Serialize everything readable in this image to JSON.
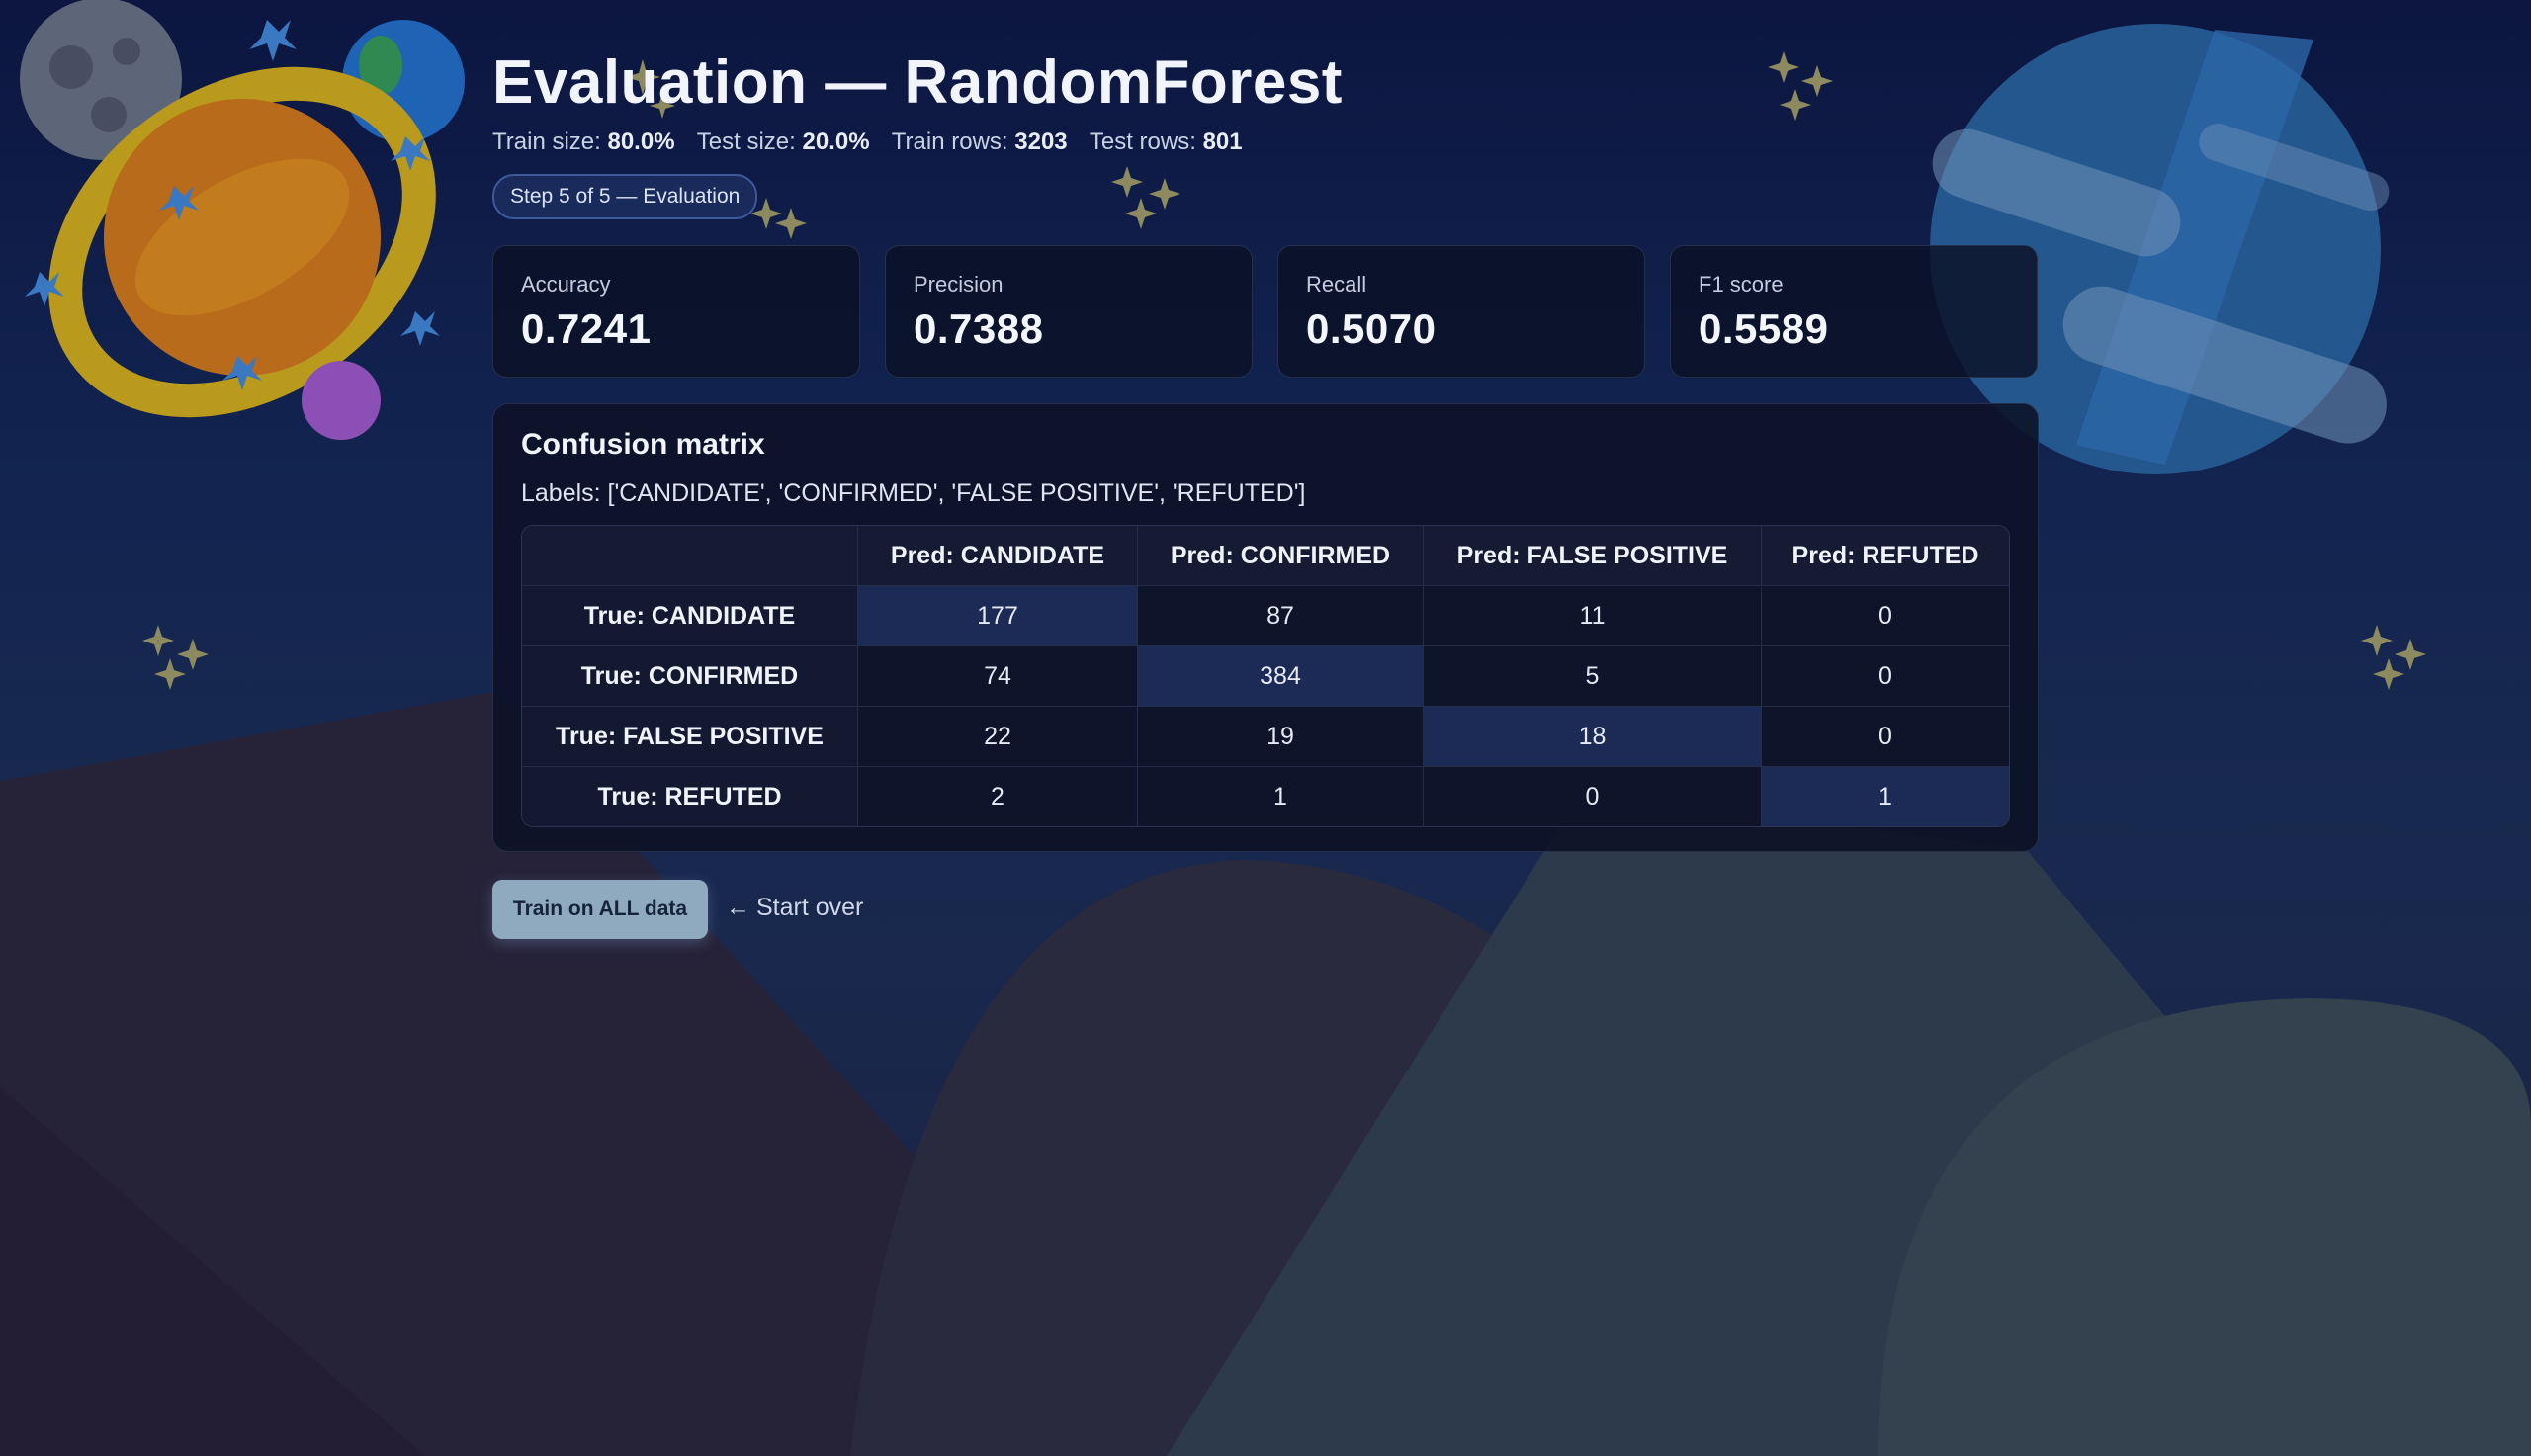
{
  "header": {
    "title": "Evaluation — RandomForest",
    "split": [
      {
        "label": "Train size:",
        "value": "80.0%"
      },
      {
        "label": "Test size:",
        "value": "20.0%"
      },
      {
        "label": "Train rows:",
        "value": "3203"
      },
      {
        "label": "Test rows:",
        "value": "801"
      }
    ],
    "step_badge": "Step 5 of 5 — Evaluation"
  },
  "metrics": [
    {
      "label": "Accuracy",
      "value": "0.7241"
    },
    {
      "label": "Precision",
      "value": "0.7388"
    },
    {
      "label": "Recall",
      "value": "0.5070"
    },
    {
      "label": "F1 score",
      "value": "0.5589"
    }
  ],
  "confusion_matrix": {
    "title": "Confusion matrix",
    "labels_text": "Labels: ['CANDIDATE', 'CONFIRMED', 'FALSE POSITIVE', 'REFUTED']",
    "columns": [
      "Pred: CANDIDATE",
      "Pred: CONFIRMED",
      "Pred: FALSE POSITIVE",
      "Pred: REFUTED"
    ],
    "rows": [
      {
        "label": "True: CANDIDATE",
        "cells": [
          "177",
          "87",
          "11",
          "0"
        ]
      },
      {
        "label": "True: CONFIRMED",
        "cells": [
          "74",
          "384",
          "5",
          "0"
        ]
      },
      {
        "label": "True: FALSE POSITIVE",
        "cells": [
          "22",
          "19",
          "18",
          "0"
        ]
      },
      {
        "label": "True: REFUTED",
        "cells": [
          "2",
          "1",
          "0",
          "1"
        ]
      }
    ]
  },
  "actions": {
    "train_all_label": "Train on ALL data",
    "start_over_arrow": "←",
    "start_over_label": "Start over"
  },
  "theme": {
    "accent": "#8fa9bf",
    "diagonal_highlight": "#1c2a56",
    "card_background": "#0b1126"
  },
  "decorations": [
    "ringed-planet-illustration",
    "cratered-moon-illustration",
    "earth-planet-illustration",
    "blue-striped-planet-illustration",
    "sparkle-stars",
    "mountain-hills"
  ]
}
